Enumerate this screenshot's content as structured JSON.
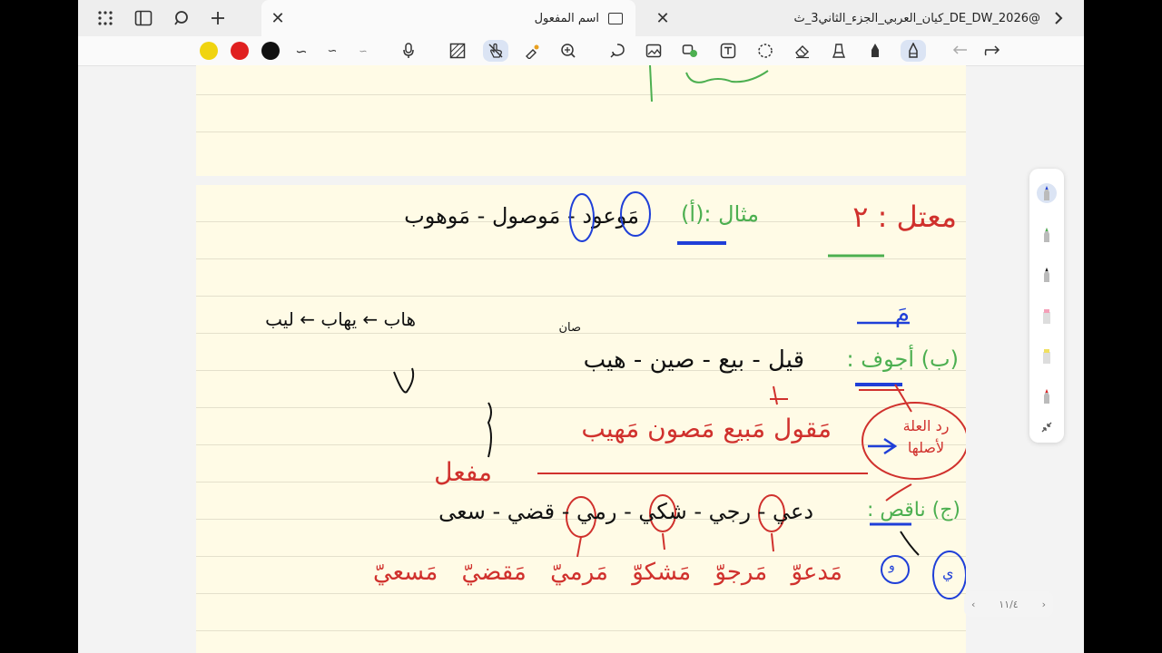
{
  "tabs": [
    {
      "title": "اسم المفعول",
      "active": true
    },
    {
      "title": "كيان_العربي_الجزء_الثاني3_ث_DE_DW_2026@",
      "active": false
    }
  ],
  "tabbar_icons": [
    "grid-icon",
    "sidebar-icon",
    "search-icon",
    "add-icon",
    "close-icon",
    "forward-icon"
  ],
  "colors": {
    "yellow": "#f0d410",
    "red": "#e02020",
    "black": "#111111",
    "ink_red": "#d0312d",
    "ink_green": "#4caf50",
    "ink_blue": "#1f3fd8"
  },
  "notes": {
    "line1_heading": "معتل : ٢",
    "line1_label": "مثال :(أ)",
    "line1_words": "مَوعود - مَوصول - مَوهوب",
    "side_top": "هاب ← يهاب ← ليب",
    "side_small": "صان",
    "blue_mark": "مَ",
    "line2_label": "(ب) أجوف :",
    "line2_words": "قيل - بيع - صين - هيب",
    "line3_words": "مَقول مَبيع مَصون مَهيب",
    "line3_note": "رد العلة لأصلها",
    "pattern": "مفعل",
    "line4_label": "(ج) ناقص :",
    "line4_words": "دعي - رجي - شكي - رمي - قضي - سعى",
    "line5_words": "مَدعوّ مَرجوّ مَشكوّ مَرميّ مَقضيّ مَسعيّ",
    "circles": [
      "و",
      "ي"
    ]
  },
  "pager": {
    "label": "١١/٤"
  }
}
